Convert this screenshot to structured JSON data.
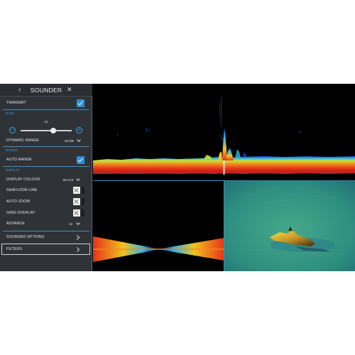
{
  "sidebar": {
    "title": "SOUNDER",
    "transmit": {
      "label": "TRANSMIT",
      "checked": true
    },
    "gain": {
      "section": "GAIN",
      "value": "12",
      "level_fraction": 0.64,
      "minus_icon": "minus-icon",
      "plus_icon": "plus-icon"
    },
    "dynamic_range": {
      "label": "DYNAMIC RANGE",
      "value": "32 DB"
    },
    "range": {
      "section": "RANGE",
      "auto_range_label": "AUTO RANGE",
      "auto_range_checked": true
    },
    "display": {
      "section": "DISPLAY",
      "display_colour_label": "DISPLAY COLOUR",
      "display_colour_value": "BLACK",
      "seafloor_line_label": "SEAFLOOR LINE",
      "seafloor_line_checked": false,
      "auto_zoom_label": "AUTO ZOOM",
      "auto_zoom_checked": false,
      "grid_overlay_label": "GRID OVERLAY",
      "grid_overlay_checked": false,
      "advance_label": "ADVANCE",
      "advance_value": "12"
    },
    "sounder_options_label": "SOUNDER OPTIONS",
    "filters_label": "FILTERS"
  },
  "colors": {
    "accent": "#2b8fd0",
    "panel_bg": "#2f3338",
    "sonar_bg": "#000000",
    "seabed_green": "#2f8c82"
  }
}
